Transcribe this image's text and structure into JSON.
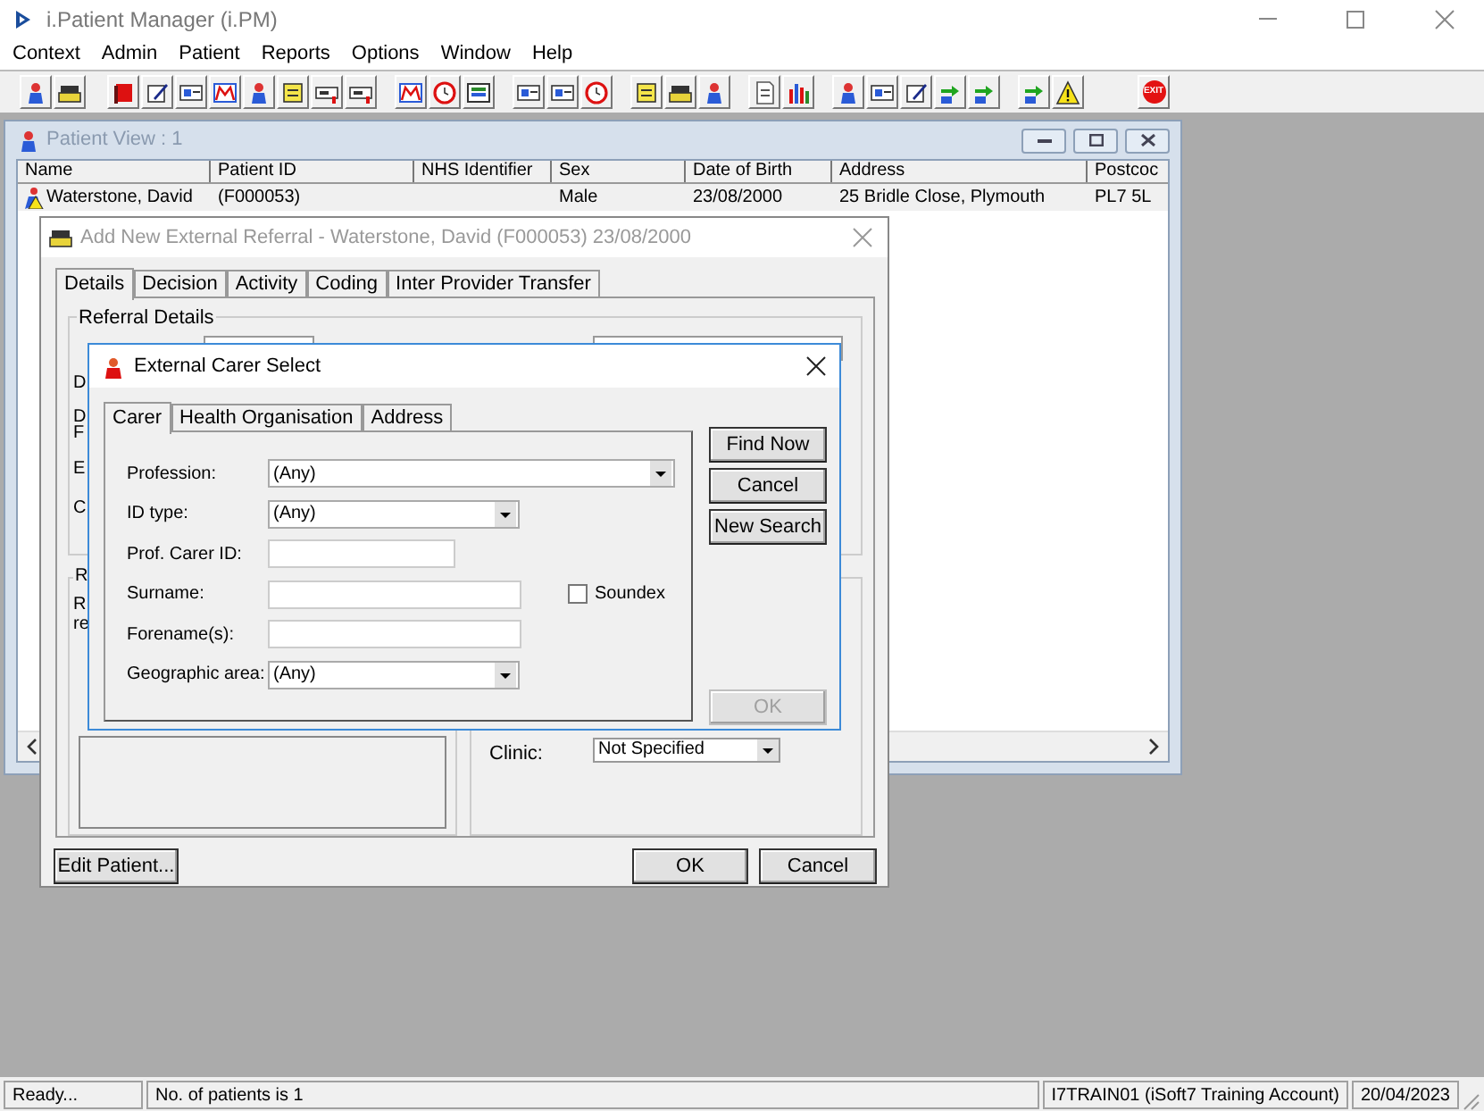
{
  "app": {
    "title": "i.Patient Manager (i.PM)",
    "exit_label": "EXIT"
  },
  "menu": [
    "Context",
    "Admin",
    "Patient",
    "Reports",
    "Options",
    "Window",
    "Help"
  ],
  "patient_view": {
    "title": "Patient View : 1",
    "columns": [
      "Name",
      "Patient ID",
      "NHS Identifier",
      "Sex",
      "Date of Birth",
      "Address",
      "Postcoc"
    ],
    "rows": [
      {
        "cells": [
          "Waterstone, David",
          "(F000053)",
          "",
          "Male",
          "23/08/2000",
          "25 Bridle Close, Plymouth",
          "PL7 5L"
        ],
        "selected": false
      }
    ]
  },
  "referral_dialog": {
    "title": "Add New External Referral - Waterstone, David (F000053) 23/08/2000",
    "tabs": [
      {
        "label": "Details",
        "selected": true
      },
      {
        "label": "Decision",
        "selected": false
      },
      {
        "label": "Activity",
        "selected": false
      },
      {
        "label": "Coding",
        "selected": false
      },
      {
        "label": "Inter Provider Transfer",
        "selected": false
      }
    ],
    "group_title": "Referral Details",
    "covered_labels": [
      "D",
      "D",
      "F",
      "E",
      "C",
      "R",
      "R",
      "re"
    ],
    "clinic_label": "Clinic:",
    "clinic_value": "Not Specified",
    "buttons": [
      "Edit Patient...",
      "OK",
      "Cancel"
    ]
  },
  "carer_dialog": {
    "title": "External Carer Select",
    "tabs": [
      {
        "label": "Carer",
        "selected": true
      },
      {
        "label": "Health Organisation",
        "selected": false
      },
      {
        "label": "Address",
        "selected": false
      }
    ],
    "fields": [
      {
        "label": "Profession:",
        "kind": "combo",
        "value": "(Any)"
      },
      {
        "label": "ID type:",
        "kind": "combo",
        "value": "(Any)"
      },
      {
        "label": "Prof. Carer ID:",
        "kind": "text"
      },
      {
        "label": "Surname:",
        "kind": "text"
      },
      {
        "label": "Forename(s):",
        "kind": "text"
      },
      {
        "label": "Geographic area:",
        "kind": "combo",
        "value": "(Any)"
      }
    ],
    "soundex": {
      "label": "Soundex",
      "checked": false
    },
    "buttons": [
      {
        "label": "Find Now",
        "disabled": false
      },
      {
        "label": "Cancel",
        "disabled": false
      },
      {
        "label": "New Search",
        "disabled": false
      },
      {
        "label": "OK",
        "disabled": true
      }
    ]
  },
  "status_bar": [
    "Ready...",
    "No. of patients is 1",
    "I7TRAIN01 (iSoft7 Training Account)",
    "20/04/2023"
  ]
}
